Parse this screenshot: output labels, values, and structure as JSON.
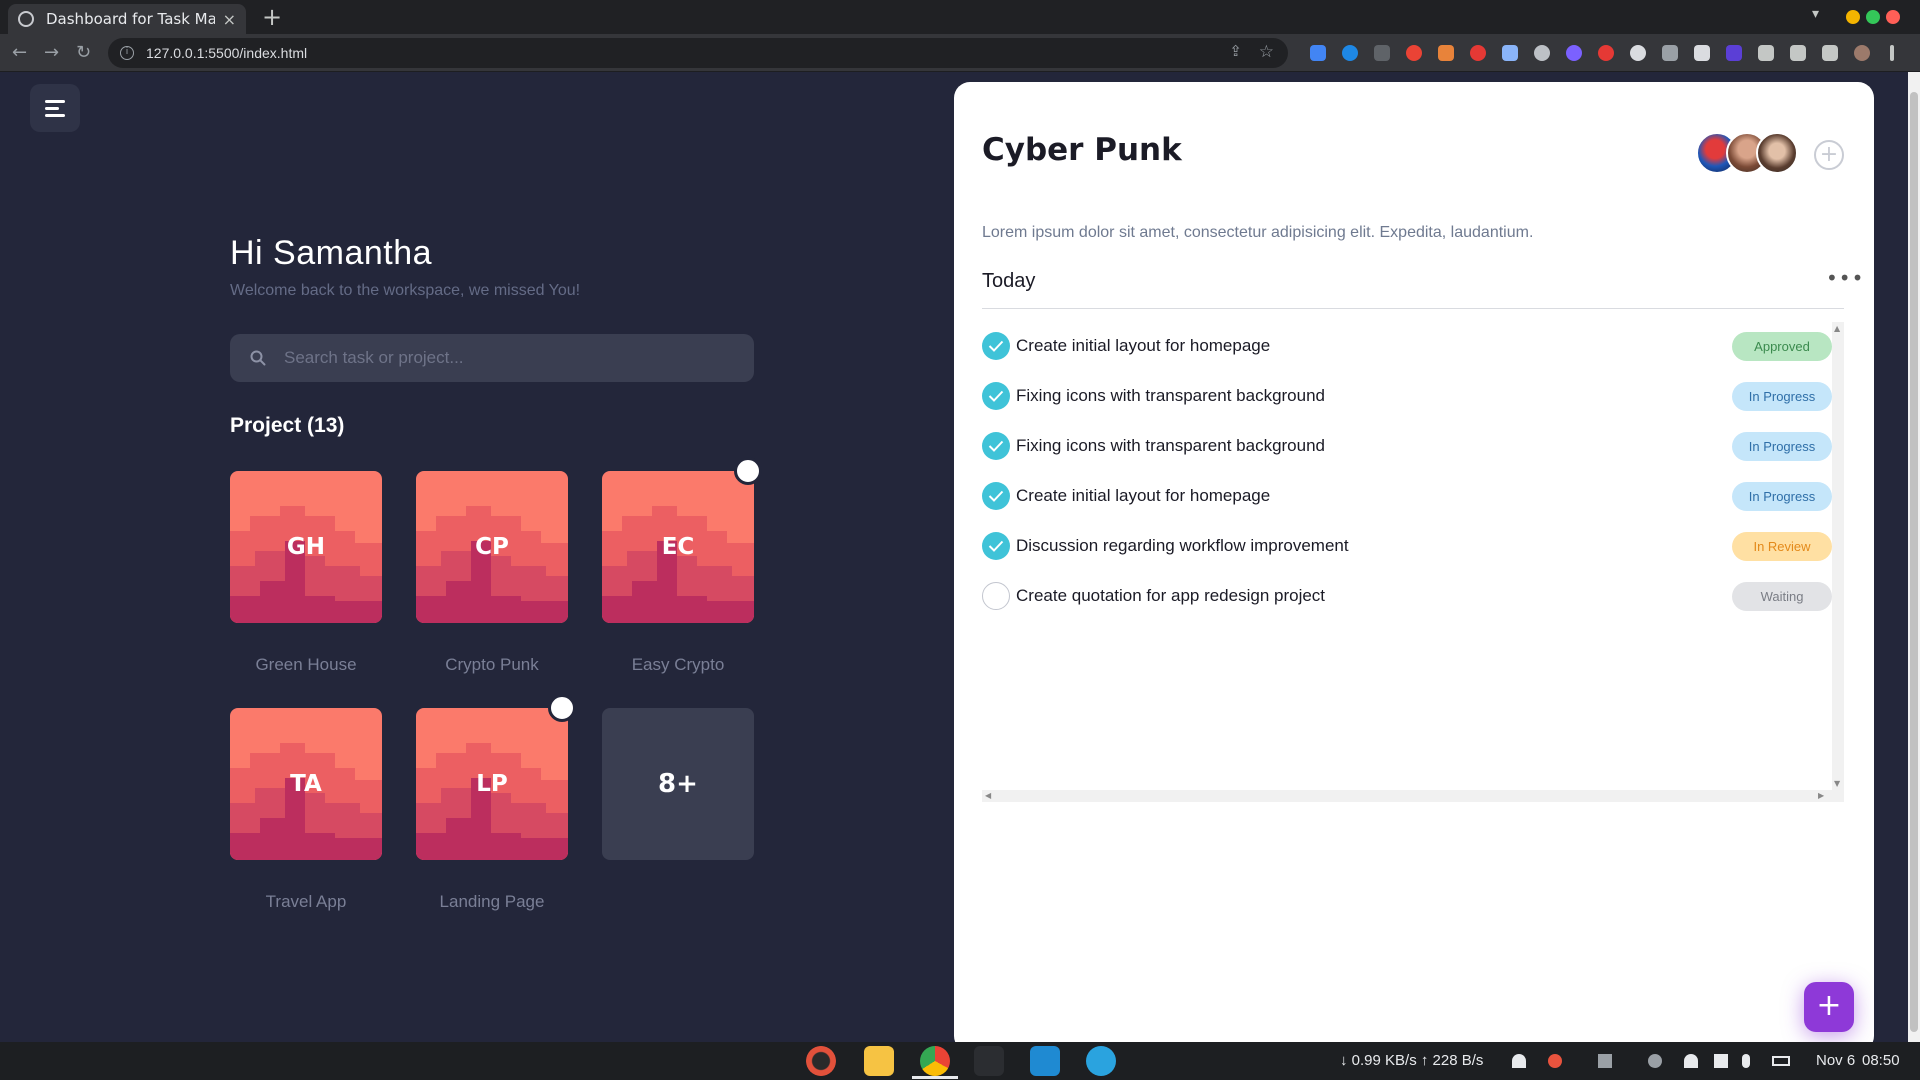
{
  "browser": {
    "tab_title": "Dashboard for Task Mana",
    "tab_close": "×",
    "new_tab": "+",
    "url": "127.0.0.1:5500/index.html"
  },
  "sidebar": {
    "menu_icon": "hamburger-menu-icon"
  },
  "greeting": {
    "title": "Hi Samantha",
    "subtitle": "Welcome back to the workspace, we missed You!"
  },
  "search": {
    "placeholder": "Search task or project...",
    "icon": "search-icon"
  },
  "projects": {
    "heading": "Project (13)",
    "items": [
      {
        "abbr": "GH",
        "name": "Green House"
      },
      {
        "abbr": "CP",
        "name": "Crypto Punk"
      },
      {
        "abbr": "EC",
        "name": "Easy Crypto"
      },
      {
        "abbr": "TA",
        "name": "Travel App"
      },
      {
        "abbr": "LP",
        "name": "Landing Page"
      }
    ],
    "more_label": "8+"
  },
  "panel": {
    "title": "Cyber Punk",
    "description": "Lorem ipsum dolor sit amet, consectetur adipisicing elit. Expedita, laudantium.",
    "section": "Today",
    "more_icon": "•••",
    "add_member_icon": "+",
    "fab_label": "+",
    "tasks": [
      {
        "text": "Create initial layout for homepage",
        "status": "Approved",
        "done": true
      },
      {
        "text": "Fixing icons with transparent background",
        "status": "In Progress",
        "done": true
      },
      {
        "text": "Fixing icons with transparent background",
        "status": "In Progress",
        "done": true
      },
      {
        "text": "Create initial layout for homepage",
        "status": "In Progress",
        "done": true
      },
      {
        "text": "Discussion regarding workflow improvement",
        "status": "In Review",
        "done": true
      },
      {
        "text": "Create quotation for app redesign project",
        "status": "Waiting",
        "done": false
      }
    ],
    "status_colors": {
      "Approved": {
        "bg": "#b8e6c2",
        "fg": "#3b8b4e"
      },
      "In Progress": {
        "bg": "#c5e6fa",
        "fg": "#2f6fa8"
      },
      "In Review": {
        "bg": "#ffe0a3",
        "fg": "#e48a1a"
      },
      "Waiting": {
        "bg": "#e2e3e6",
        "fg": "#7a7d85"
      }
    }
  },
  "taskbar": {
    "network": "↓ 0.99 KB/s ↑ 228 B/s",
    "date": "Nov 6",
    "time": "08:50"
  },
  "colors": {
    "background": "#23263a",
    "card": "#fb7a6b",
    "accent": "#8e39d8",
    "check": "#3fc3d8"
  }
}
